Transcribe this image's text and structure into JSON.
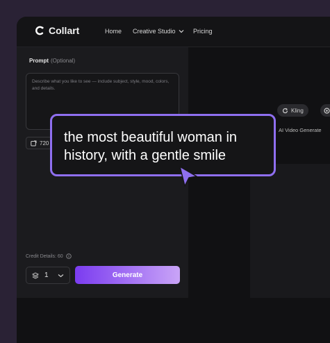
{
  "brand": {
    "name": "Collart"
  },
  "nav": {
    "home": "Home",
    "creative_studio": "Creative Studio",
    "pricing": "Pricing"
  },
  "prompt": {
    "label": "Prompt",
    "optional": "(Optional)",
    "placeholder": "Describe what you like to see — include subject, style, mood, colors, and details."
  },
  "resolution": {
    "value": "720"
  },
  "credit": {
    "label": "Credit Details: 60"
  },
  "quantity": {
    "value": "1"
  },
  "generate": {
    "label": "Generate"
  },
  "models": {
    "kling": "Kling"
  },
  "right": {
    "label": "AI Video Generate"
  },
  "tooltip": {
    "text": "the most beautiful woman in history, with a gentle smile"
  },
  "colors": {
    "accent": "#8f6ff0",
    "generate_start": "#7b3cf0",
    "generate_end": "#c9a4f7"
  }
}
